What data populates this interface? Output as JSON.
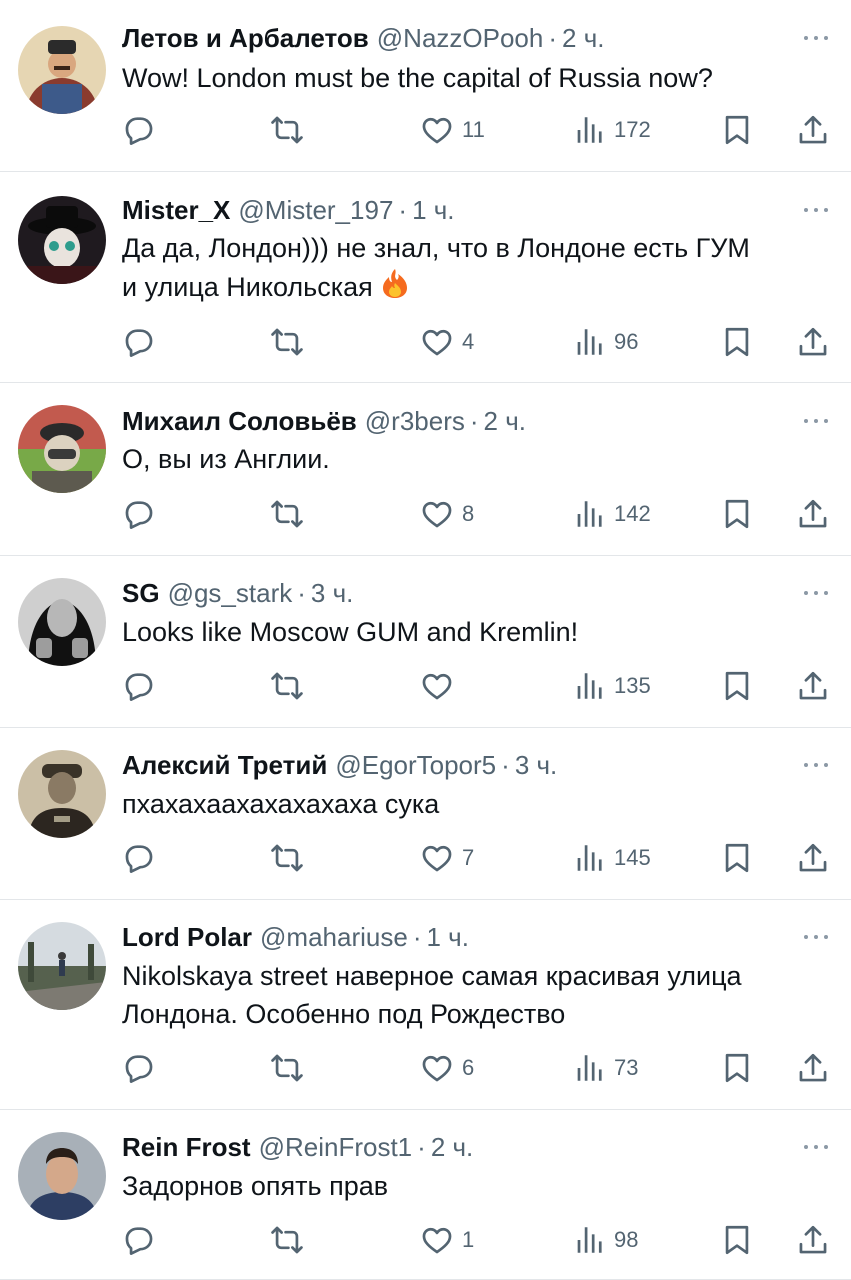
{
  "tweets": [
    {
      "name": "Летов и Арбалетов",
      "handle": "@NazzOPooh",
      "time": "2 ч.",
      "text": [
        "Wow! London must be the capital of Russia now?"
      ],
      "likes": "11",
      "views": "172",
      "avatar": "avatar-cossack"
    },
    {
      "name": "Mister_X",
      "handle": "@Mister_197",
      "time": "1 ч.",
      "text": [
        "Да да, Лондон))) не знал, что в Лондоне есть ГУМ",
        "и улица Никольская"
      ],
      "emoji": "fire-emoji",
      "likes": "4",
      "views": "96",
      "avatar": "avatar-hat-mask"
    },
    {
      "name": "Михаил Соловьёв",
      "handle": "@r3bers",
      "time": "2 ч.",
      "text": [
        "О, вы из Англии."
      ],
      "likes": "8",
      "views": "142",
      "avatar": "avatar-soldier"
    },
    {
      "name": "SG",
      "handle": "@gs_stark",
      "time": "3 ч.",
      "text": [
        "Looks like Moscow GUM and Kremlin!"
      ],
      "likes": "",
      "views": "135",
      "avatar": "avatar-statue"
    },
    {
      "name": "Алексий Третий",
      "handle": "@EgorTopor5",
      "time": "3 ч.",
      "text": [
        "пхахахаахахахахаха сука"
      ],
      "likes": "7",
      "views": "145",
      "avatar": "avatar-vintage-officer"
    },
    {
      "name": "Lord Polar",
      "handle": "@mahariuse",
      "time": "1 ч.",
      "text": [
        "Nikolskaya street наверное самая красивая улица",
        "Лондона. Особенно под Рождество"
      ],
      "likes": "6",
      "views": "73",
      "avatar": "avatar-runner"
    },
    {
      "name": "Rein Frost",
      "handle": "@ReinFrost1",
      "time": "2 ч.",
      "text": [
        "Задорнов опять прав"
      ],
      "likes": "1",
      "views": "98",
      "avatar": "avatar-man"
    }
  ],
  "separator": "·",
  "colors": {
    "text": "#0f1419",
    "secondary": "#536471",
    "divider": "#e3e6e9"
  }
}
